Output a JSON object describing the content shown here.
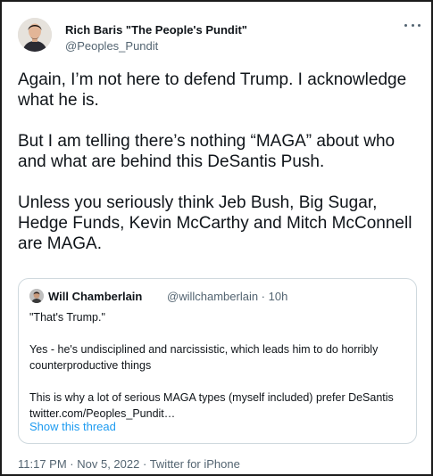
{
  "author": {
    "name": "Rich Baris \"The People's Pundit\"",
    "handle": "@Peoples_Pundit"
  },
  "more_icon": "more-horizontal-icon",
  "tweet": {
    "paragraphs": [
      "Again, I’m not here to defend Trump. I acknowledge what he is.",
      "But I am telling there’s nothing “MAGA” about who and what are behind this DeSantis Push.",
      "Unless you seriously think Jeb Bush, Big Sugar, Hedge Funds, Kevin McCarthy and Mitch McConnell are MAGA."
    ]
  },
  "quote": {
    "name": "Will Chamberlain",
    "meta": "@willchamberlain · 10h",
    "paragraphs": [
      "\"That's Trump.\"",
      "Yes - he's undisciplined and narcissistic, which leads him to do horribly counterproductive things",
      "This is why a lot of serious MAGA types (myself included) prefer DeSantis twitter.com/Peoples_Pundit…"
    ],
    "show_thread": "Show this thread"
  },
  "footer": {
    "time": "11:17 PM",
    "sep1": " · ",
    "date": "Nov 5, 2022",
    "sep2": " · ",
    "source": "Twitter for iPhone"
  },
  "colors": {
    "text": "#0f1419",
    "secondary": "#536471",
    "link": "#1d9bf0",
    "border": "#cfd9de"
  }
}
